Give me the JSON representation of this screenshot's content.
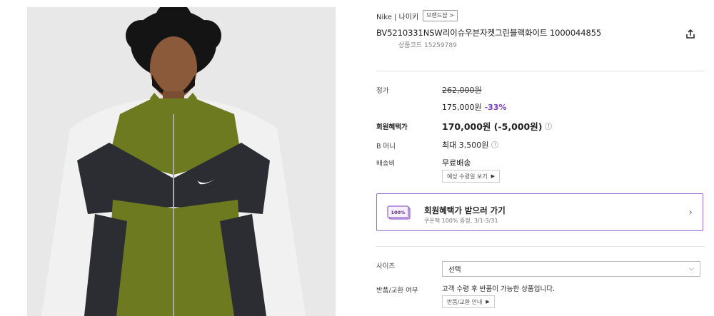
{
  "brand": {
    "name": "Nike | 나이키",
    "shop_label": "브랜드샵 >"
  },
  "product": {
    "title": "BV5210331NSW리이슈우븐자켓그린블랙화이트 1000044855",
    "code": "상품코드 15259789"
  },
  "icons": {
    "share": "share-icon",
    "info": "info-icon",
    "ticket": "coupon-ticket-icon"
  },
  "price": {
    "label": "정가",
    "original": "262,000원",
    "sale": "175,000원",
    "discount": "-33%"
  },
  "member": {
    "label": "회원혜택가",
    "value": "170,000원 (-5,000원)",
    "info": "!"
  },
  "bmoney": {
    "label": "B 머니",
    "value": "최대 3,500원",
    "info": "!"
  },
  "shipping": {
    "label": "배송비",
    "value": "무료배송",
    "button": "예상 수령일 보기",
    "arrow": "▶"
  },
  "benefit": {
    "ticket_text": "100%",
    "title": "회원혜택가 받으러 가기",
    "sub": "쿠폰팩 100% 증정, 3/1-3/31",
    "chevron": "›"
  },
  "size": {
    "label": "사이즈",
    "selected": "선택",
    "chevron": "⌵"
  },
  "return": {
    "label": "반품/교환 여부",
    "value": "고객 수령 후 반품이 가능한 상품입니다.",
    "button": "반품/교환 안내",
    "arrow": "▶"
  },
  "colors": {
    "accent": "#7b3fbf",
    "box_border": "#9b6bd1",
    "jacket_green": "#6e7a1f",
    "jacket_black": "#2b2d33",
    "jacket_white": "#f2f2f2",
    "photo_bg": "#e6e6e6"
  }
}
